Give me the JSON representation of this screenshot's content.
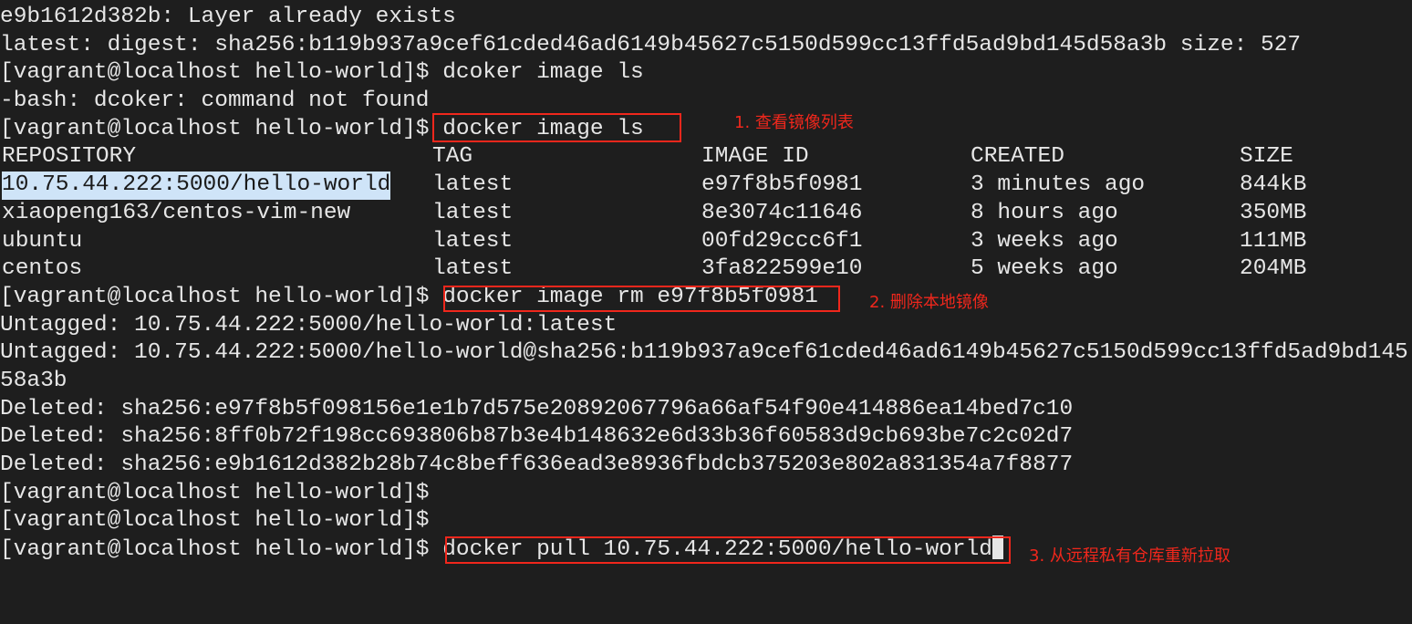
{
  "terminal": {
    "prompt": "[vagrant@localhost hello-world]$ ",
    "lines": {
      "l0": "e9b1612d382b: Layer already exists",
      "l1": "latest: digest: sha256:b119b937a9cef61cded46ad6149b45627c5150d599cc13ffd5ad9bd145d58a3b size: 527",
      "l2_cmd": "dcoker image ls",
      "l3": "-bash: dcoker: command not found",
      "l4_cmd": "docker image ls",
      "l10_cmd": "docker image rm e97f8b5f0981",
      "l11": "Untagged: 10.75.44.222:5000/hello-world:latest",
      "l12": "Untagged: 10.75.44.222:5000/hello-world@sha256:b119b937a9cef61cded46ad6149b45627c5150d599cc13ffd5ad9bd145",
      "l13": "58a3b",
      "l14": "Deleted: sha256:e97f8b5f098156e1e1b7d575e20892067796a66af54f90e414886ea14bed7c10",
      "l15": "Deleted: sha256:8ff0b72f198cc693806b87b3e4b148632e6d33b36f60583d9cb693be7c2c02d7",
      "l16": "Deleted: sha256:e9b1612d382b28b74c8beff636ead3e8936fbdcb375203e802a831354a7f8877",
      "l19_cmd": "docker pull 10.75.44.222:5000/hello-world"
    },
    "table": {
      "headers": [
        "REPOSITORY",
        "TAG",
        "IMAGE ID",
        "CREATED",
        "SIZE"
      ],
      "rows": [
        [
          "10.75.44.222:5000/hello-world",
          "latest",
          "e97f8b5f0981",
          "3 minutes ago",
          "844kB"
        ],
        [
          "xiaopeng163/centos-vim-new",
          "latest",
          "8e3074c11646",
          "8 hours ago",
          "350MB"
        ],
        [
          "ubuntu",
          "latest",
          "00fd29ccc6f1",
          "3 weeks ago",
          "111MB"
        ],
        [
          "centos",
          "latest",
          "3fa822599e10",
          "5 weeks ago",
          "204MB"
        ]
      ]
    }
  },
  "annotations": {
    "a1": "1. 查看镜像列表",
    "a2": "2. 删除本地镜像",
    "a3": "3. 从远程私有仓库重新拉取"
  },
  "colors": {
    "background": "#1e1e1e",
    "annotation": "#f0271c",
    "selection": "#cfe4f8"
  }
}
